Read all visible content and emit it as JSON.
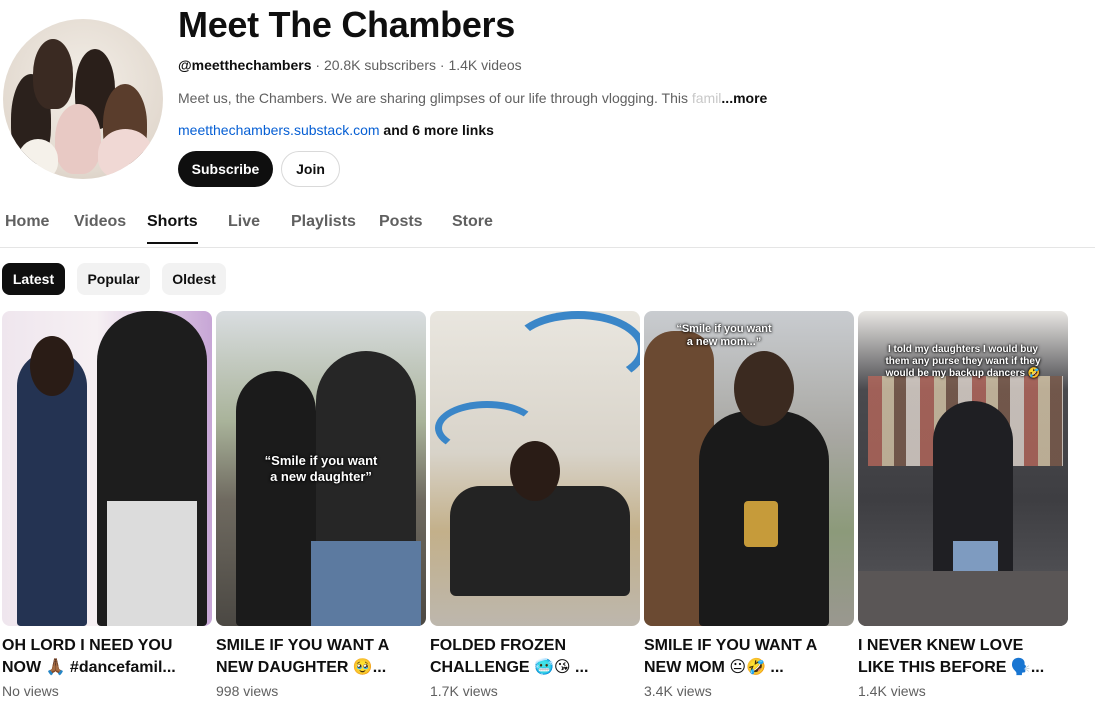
{
  "channel": {
    "name": "Meet The Chambers",
    "handle": "@meetthechambers",
    "subscribers": "20.8K subscribers",
    "videos": "1.4K videos",
    "separator": "·",
    "description": "Meet us, the Chambers.  We are sharing glimpses of our life through vlogging.  This",
    "description_fade": " famil",
    "more_label": "...more",
    "link_text": "meetthechambers.substack.com",
    "more_links": "and 6 more links",
    "subscribe_label": "Subscribe",
    "join_label": "Join"
  },
  "tabs": [
    {
      "label": "Home"
    },
    {
      "label": "Videos"
    },
    {
      "label": "Shorts",
      "active": true
    },
    {
      "label": "Live"
    },
    {
      "label": "Playlists"
    },
    {
      "label": "Posts"
    },
    {
      "label": "Store"
    }
  ],
  "filters": [
    {
      "label": "Latest",
      "active": true
    },
    {
      "label": "Popular"
    },
    {
      "label": "Oldest"
    }
  ],
  "shorts": [
    {
      "title_line1": "OH LORD I NEED YOU",
      "title_line2": "NOW 🙏🏾 #dancefamil...",
      "views": "No views",
      "caption": ""
    },
    {
      "title_line1": "SMILE IF YOU WANT A",
      "title_line2": "NEW DAUGHTER 🥹...",
      "views": "998 views",
      "caption": "“Smile if you want\na new daughter”"
    },
    {
      "title_line1": "FOLDED FROZEN",
      "title_line2": "CHALLENGE 🥶😘 ...",
      "views": "1.7K views",
      "caption": ""
    },
    {
      "title_line1": "SMILE IF YOU WANT A",
      "title_line2": "NEW MOM 😐🤣 ...",
      "views": "3.4K views",
      "caption": "“Smile if you want\na new mom...”"
    },
    {
      "title_line1": "I NEVER KNEW LOVE",
      "title_line2": "LIKE THIS BEFORE 🗣️...",
      "views": "1.4K views",
      "caption": "I told my daughters I would buy\nthem any purse they want if they\nwould be my backup dancers 🤣"
    }
  ],
  "colors": {
    "accent": "#0f0f0f",
    "link": "#065fd4",
    "muted": "#606060",
    "chip": "#f2f2f2"
  }
}
